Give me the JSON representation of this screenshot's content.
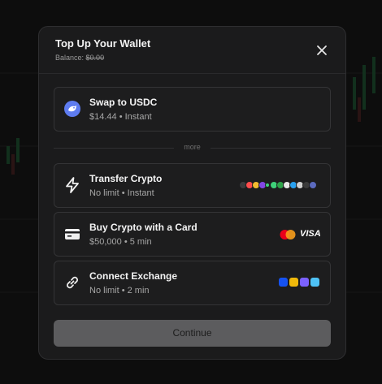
{
  "modal": {
    "title": "Top Up Your Wallet",
    "balance_label": "Balance:",
    "balance_value": "$0.00"
  },
  "options": [
    {
      "label": "Swap to USDC",
      "subtitle": "$14.44 • Instant",
      "icon": "swap-icon"
    },
    {
      "label": "Transfer Crypto",
      "subtitle": "No limit • Instant",
      "icon": "lightning-icon"
    },
    {
      "label": "Buy Crypto with a Card",
      "subtitle": "$50,000 • 5 min",
      "icon": "credit-card-icon"
    },
    {
      "label": "Connect Exchange",
      "subtitle": "No limit • 2 min",
      "icon": "link-icon"
    }
  ],
  "divider_text": "more",
  "card_brands": {
    "visa": "VISA"
  },
  "continue_label": "Continue",
  "colors": {
    "modal_bg": "#1b1b1c",
    "swap_accent": "#5e7cf0",
    "continue_bg": "#5c5c5e",
    "mastercard_red": "#eb001b",
    "mastercard_orange": "#f79e1b"
  }
}
